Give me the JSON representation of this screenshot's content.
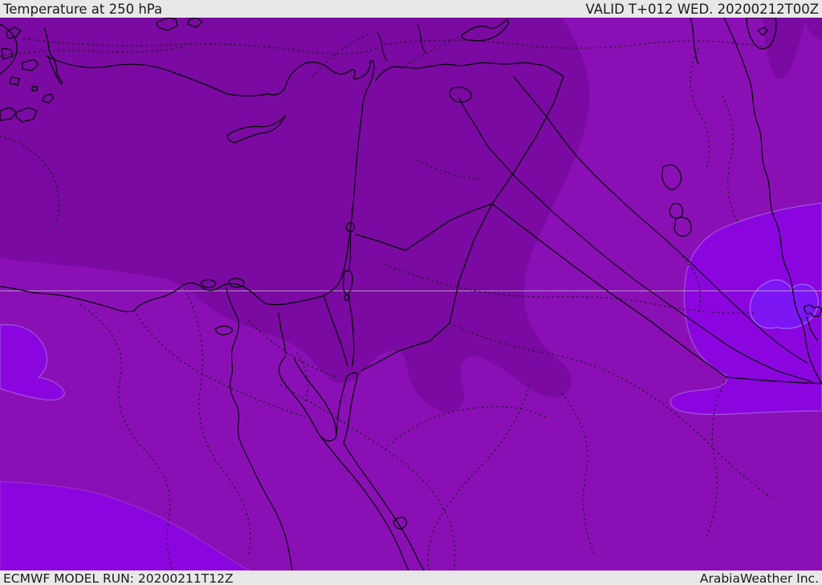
{
  "header": {
    "title": "Temperature at 250 hPa",
    "valid_time": "VALID T+012 WED. 20200212T00Z"
  },
  "footer": {
    "model_run": "ECMWF MODEL RUN: 20200211T12Z",
    "credit": "ArabiaWeather Inc."
  },
  "map": {
    "parameter": "Temperature",
    "level": "250 hPa",
    "region": "Middle East / Eastern Mediterranean",
    "bands": [
      {
        "name": "coldest-band",
        "color": "#7a0aa2"
      },
      {
        "name": "cold-band",
        "color": "#8a10b6"
      },
      {
        "name": "mild-band",
        "color": "#8b06de"
      },
      {
        "name": "warmest-band",
        "color": "#7c17f3"
      }
    ]
  },
  "colors": {
    "band_dark": "#7a0aa2",
    "band_medium": "#8a10b6",
    "band_bright": "#8b06de",
    "band_brightest": "#7c17f3",
    "band_bright_edge": "#a24fe0",
    "band_brightest_edge": "#9d55f6",
    "bar_background": "#e8e8e8",
    "bar_text": "#1b1b1b",
    "gridline": "#c8aed2",
    "border_lines": "#000000"
  }
}
